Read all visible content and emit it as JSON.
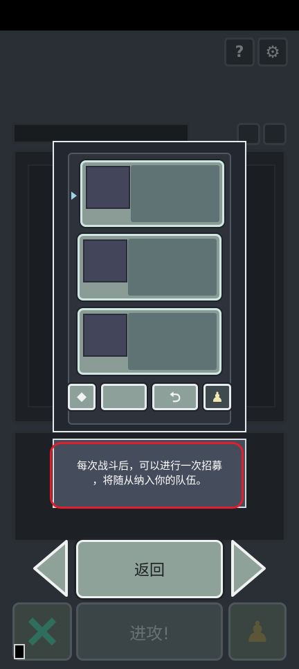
{
  "tooltip": {
    "line1": "每次战斗后，可以进行一次招募",
    "line2": "，将随从纳入你的队伍。"
  },
  "nav": {
    "back_label": "返回"
  },
  "footer": {
    "attack_label": "进攻!"
  },
  "colors": {
    "highlight_ring": "#e21e2c",
    "card_border": "#cfe6e3",
    "button_face": "#8fa29a"
  },
  "icons": {
    "help": "help-icon",
    "settings": "gear-icon",
    "gem": "gem-icon",
    "reroll": "reroll-icon",
    "unit": "pawn-icon",
    "cancel": "x-icon"
  }
}
